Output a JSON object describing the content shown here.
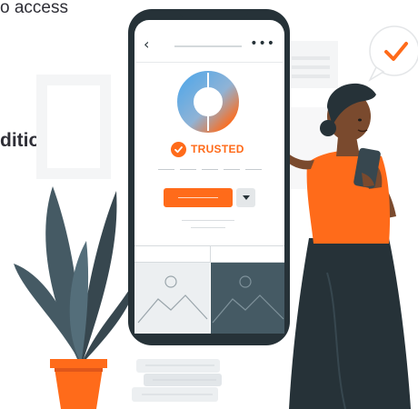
{
  "snippets": {
    "top": "o access",
    "mid": "dition"
  },
  "app": {
    "badge_label": "TRUSTED"
  },
  "icons": {
    "back": "chevron-left-icon",
    "more": "more-horizontal-icon",
    "check": "check-icon",
    "dropdown": "caret-down-icon",
    "image": "image-placeholder-icon"
  },
  "colors": {
    "accent": "#ff6b1a",
    "dark": "#263238",
    "slate": "#455a64",
    "donut_blue": "#5aa9e6"
  }
}
